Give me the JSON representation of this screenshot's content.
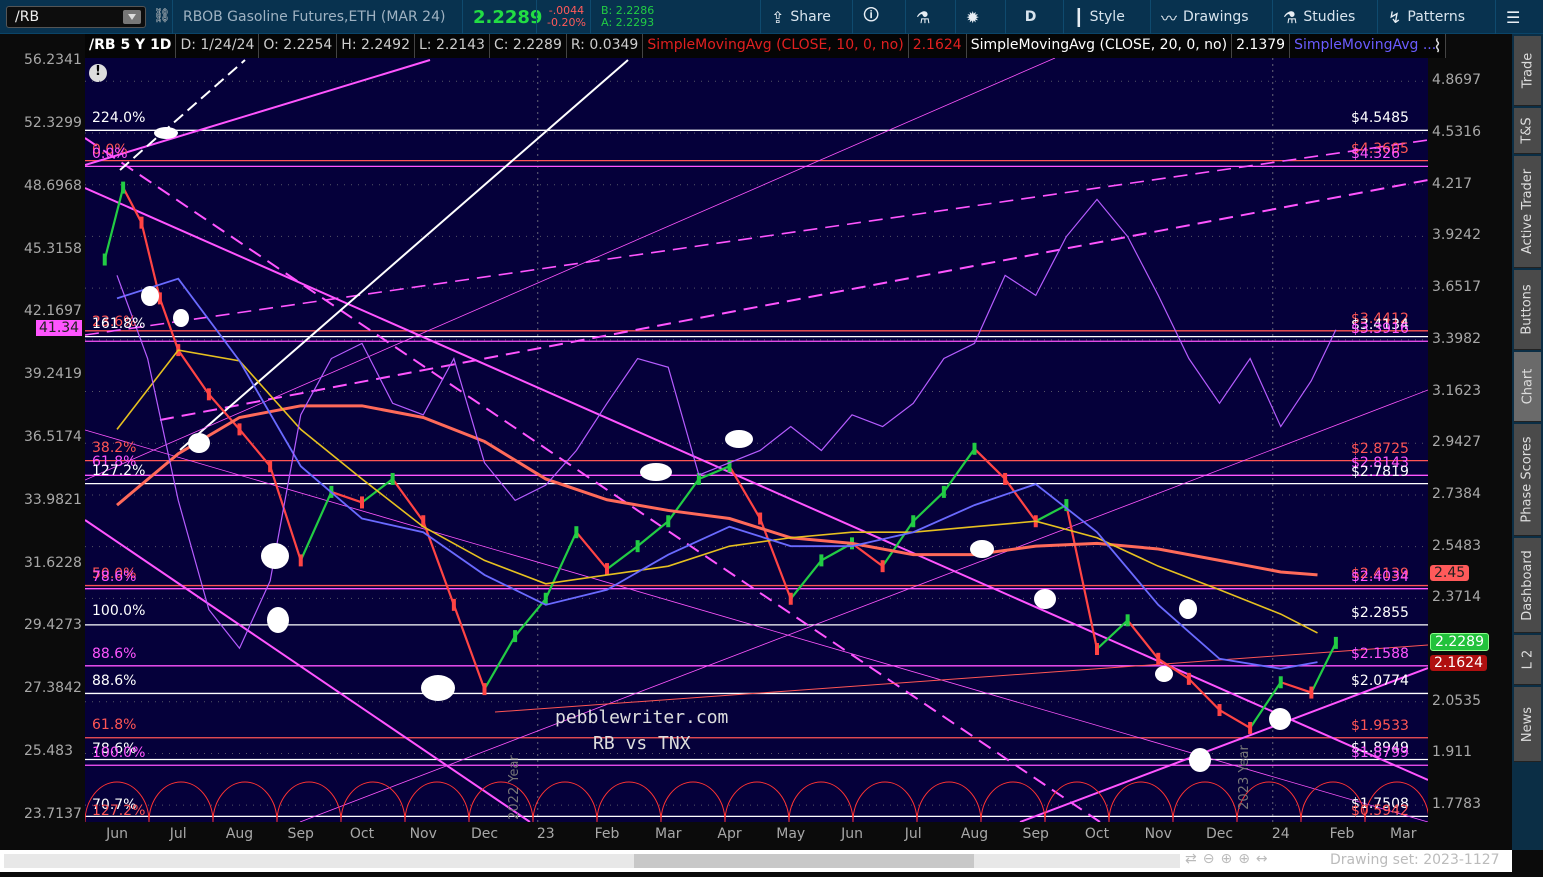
{
  "toolbar": {
    "symbol": "/RB",
    "description": "RBOB Gasoline Futures,ETH (MAR 24)",
    "last": "2.2289",
    "change": "-.0044",
    "change_pct": "-0.20%",
    "bid": "B: 2.2286",
    "ask": "A: 2.2293",
    "buttons": [
      {
        "label": "Share",
        "icon": "share-icon"
      },
      {
        "label": "",
        "icon": "info-icon"
      },
      {
        "label": "",
        "icon": "flask-icon"
      },
      {
        "label": "",
        "icon": "gear-icon"
      },
      {
        "label": "D",
        "icon": ""
      },
      {
        "label": "Style",
        "icon": "candle-icon"
      },
      {
        "label": "Drawings",
        "icon": "drawings-icon"
      },
      {
        "label": "Studies",
        "icon": "flask-icon"
      },
      {
        "label": "Patterns",
        "icon": "patterns-icon"
      },
      {
        "label": "",
        "icon": "menu-icon"
      }
    ]
  },
  "info": {
    "title": "/RB 5 Y 1D",
    "date": "D: 1/24/24",
    "open": "O: 2.2254",
    "high": "H: 2.2492",
    "low": "L: 2.2143",
    "close": "C: 2.2289",
    "range": "R: 0.0349",
    "sma1": "SimpleMovingAvg (CLOSE, 10, 0, no)",
    "sma1_val": "2.1624",
    "sma2": "SimpleMovingAvg (CLOSE, 20, 0, no)",
    "sma2_val": "2.1379",
    "sma3": "SimpleMovingAvg ..."
  },
  "left_axis": [
    "56.2341",
    "52.3299",
    "48.6968",
    "45.3158",
    "42.1697",
    "39.2419",
    "36.5174",
    "33.9821",
    "31.6228",
    "29.4273",
    "27.3842",
    "25.483",
    "23.7137"
  ],
  "left_badge": "41.34",
  "right_axis": [
    "4.8697",
    "4.5316",
    "4.217",
    "3.9242",
    "3.6517",
    "3.3982",
    "3.1623",
    "2.9427",
    "2.7384",
    "2.5483",
    "2.3714",
    "2.0535",
    "1.911",
    "1.7783"
  ],
  "badges": {
    "sma200": "2.45",
    "last": "2.2289",
    "sma10": "2.1624"
  },
  "colors": {
    "up": "#22cc44",
    "down": "#ff4444",
    "tnx": "#b65cff",
    "fib_white": "#ffffff",
    "fib_red": "#ff5555",
    "fib_magenta": "#ff55ff"
  },
  "fib_right": [
    {
      "label": "$4.5485",
      "price": 4.5485,
      "color": "#ffffff"
    },
    {
      "label": "$4.3605",
      "price": 4.3605,
      "color": "#ff5555"
    },
    {
      "label": "$4.326",
      "price": 4.326,
      "color": "#ff55ff"
    },
    {
      "label": "$3.4412",
      "price": 3.4412,
      "color": "#ff5555"
    },
    {
      "label": "$3.4134",
      "price": 3.4134,
      "color": "#ffffff"
    },
    {
      "label": "$3.3916",
      "price": 3.3916,
      "color": "#ff55ff"
    },
    {
      "label": "$2.8725",
      "price": 2.8725,
      "color": "#ff5555"
    },
    {
      "label": "$2.8143",
      "price": 2.8143,
      "color": "#ff55ff"
    },
    {
      "label": "$2.7819",
      "price": 2.7819,
      "color": "#ffffff"
    },
    {
      "label": "$2.4139",
      "price": 2.4139,
      "color": "#ff5555"
    },
    {
      "label": "$2.4034",
      "price": 2.4034,
      "color": "#ff55ff"
    },
    {
      "label": "$2.2855",
      "price": 2.2855,
      "color": "#ffffff"
    },
    {
      "label": "$2.1588",
      "price": 2.1588,
      "color": "#ff55ff"
    },
    {
      "label": "$2.0774",
      "price": 2.0774,
      "color": "#ffffff"
    },
    {
      "label": "$1.9533",
      "price": 1.9533,
      "color": "#ff5555"
    },
    {
      "label": "$1.8949",
      "price": 1.8949,
      "color": "#ffffff"
    },
    {
      "label": "$1.8799",
      "price": 1.8799,
      "color": "#ff55ff"
    },
    {
      "label": "$1.7508",
      "price": 1.7508,
      "color": "#ffffff"
    },
    {
      "label": "$0.5942",
      "price": 1.735,
      "color": "#ff5555"
    }
  ],
  "fib_left": [
    {
      "label": "224.0%",
      "color": "#ffffff"
    },
    {
      "label": "0.0%",
      "color": "#ff5555"
    },
    {
      "label": "0.0%",
      "color": "#ff55ff"
    },
    {
      "label": "23.6%",
      "color": "#ff5555"
    },
    {
      "label": "161.8%",
      "color": "#ffffff"
    },
    {
      "label": "38.2%",
      "color": "#ff5555"
    },
    {
      "label": "61.8%",
      "color": "#ff55ff"
    },
    {
      "label": "127.2%",
      "color": "#ffffff"
    },
    {
      "label": "50.0%",
      "color": "#ff5555"
    },
    {
      "label": "78.6%",
      "color": "#ff55ff"
    },
    {
      "label": "100.0%",
      "color": "#ffffff"
    },
    {
      "label": "88.6%",
      "color": "#ff55ff"
    },
    {
      "label": "88.6%",
      "color": "#ffffff"
    },
    {
      "label": "61.8%",
      "color": "#ff5555"
    },
    {
      "label": "78.6%",
      "color": "#ffffff"
    },
    {
      "label": "100.0%",
      "color": "#ff55ff"
    },
    {
      "label": "70.7%",
      "color": "#ffffff"
    },
    {
      "label": "127.2%",
      "color": "#ff5555"
    }
  ],
  "time_axis": [
    "Jun",
    "Jul",
    "Aug",
    "Sep",
    "Oct",
    "Nov",
    "Dec",
    "23",
    "Feb",
    "Mar",
    "Apr",
    "May",
    "Jun",
    "Jul",
    "Aug",
    "Sep",
    "Oct",
    "Nov",
    "Dec",
    "24",
    "Feb",
    "Mar"
  ],
  "watermark": {
    "site": "pebblewriter.com",
    "subtitle": "RB vs TNX",
    "year1": "2022 Year",
    "year2": "2023 Year"
  },
  "tabs": [
    "Trade",
    "T&S",
    "Active Trader",
    "Buttons",
    "Chart",
    "Phase Scores",
    "Dashboard",
    "L 2",
    "News"
  ],
  "bottom": {
    "drawing_set": "Drawing set: 2023-1127"
  },
  "chart_data": {
    "type": "line",
    "x_unit": "months since Jun 2022",
    "series": [
      {
        "name": "/RB close",
        "axis": "right",
        "x": [
          -0.2,
          0.1,
          0.4,
          0.7,
          1,
          1.5,
          2,
          2.5,
          3,
          3.5,
          4,
          4.5,
          5,
          5.5,
          6,
          6.5,
          7,
          7.5,
          8,
          8.5,
          9,
          9.5,
          10,
          10.5,
          11,
          11.5,
          12,
          12.5,
          13,
          13.5,
          14,
          14.5,
          15,
          15.5,
          16,
          16.5,
          17,
          17.5,
          18,
          18.5,
          19,
          19.5,
          19.9
        ],
        "values": [
          3.8,
          4.2,
          4.0,
          3.6,
          3.35,
          3.15,
          3.0,
          2.85,
          2.5,
          2.75,
          2.71,
          2.8,
          2.64,
          2.35,
          2.09,
          2.25,
          2.37,
          2.6,
          2.47,
          2.55,
          2.64,
          2.8,
          2.85,
          2.65,
          2.37,
          2.5,
          2.56,
          2.48,
          2.64,
          2.75,
          2.92,
          2.8,
          2.64,
          2.7,
          2.21,
          2.3,
          2.18,
          2.12,
          2.03,
          1.98,
          2.11,
          2.08,
          2.2289
        ]
      },
      {
        "name": "SMA 200",
        "axis": "right",
        "x": [
          0,
          1,
          2,
          3,
          4,
          5,
          6,
          7,
          8,
          9,
          10,
          11,
          12,
          13,
          14,
          15,
          16,
          17,
          18,
          19,
          19.6
        ],
        "values": [
          2.7,
          2.9,
          3.05,
          3.1,
          3.1,
          3.05,
          2.95,
          2.8,
          2.72,
          2.68,
          2.65,
          2.58,
          2.56,
          2.52,
          2.52,
          2.55,
          2.56,
          2.54,
          2.5,
          2.46,
          2.45
        ]
      },
      {
        "name": "SMA 100",
        "axis": "right",
        "x": [
          0,
          1,
          2,
          3,
          4,
          5,
          6,
          7,
          8,
          9,
          10,
          11,
          12,
          13,
          14,
          15,
          16,
          17,
          18,
          19,
          19.6
        ],
        "values": [
          3.0,
          3.35,
          3.3,
          3.0,
          2.8,
          2.62,
          2.5,
          2.42,
          2.45,
          2.48,
          2.55,
          2.58,
          2.6,
          2.6,
          2.62,
          2.64,
          2.58,
          2.48,
          2.4,
          2.32,
          2.26
        ]
      },
      {
        "name": "SMA 50",
        "axis": "right",
        "x": [
          0,
          1,
          2,
          3,
          4,
          5,
          6,
          7,
          8,
          9,
          10,
          11,
          12,
          13,
          14,
          15,
          16,
          17,
          18,
          19,
          19.6
        ],
        "values": [
          3.6,
          3.7,
          3.3,
          2.85,
          2.65,
          2.6,
          2.45,
          2.35,
          2.4,
          2.52,
          2.62,
          2.55,
          2.55,
          2.6,
          2.7,
          2.78,
          2.6,
          2.35,
          2.18,
          2.15,
          2.17
        ]
      },
      {
        "name": "TNX x10",
        "axis": "left",
        "x": [
          0,
          0.5,
          1,
          1.5,
          2,
          2.5,
          3,
          3.5,
          4,
          4.5,
          5,
          5.5,
          6,
          6.5,
          7,
          7.5,
          8,
          8.5,
          9,
          9.5,
          10,
          10.5,
          11,
          11.5,
          12,
          12.5,
          13,
          13.5,
          14,
          14.5,
          15,
          15.5,
          16,
          16.5,
          17,
          17.5,
          18,
          18.5,
          19,
          19.5,
          19.9
        ],
        "values": [
          44,
          40,
          34,
          30,
          28.7,
          31,
          37.5,
          40,
          40.7,
          38,
          37.5,
          40,
          35.5,
          34,
          34.6,
          36,
          38,
          40,
          39.6,
          35,
          35.5,
          36,
          37,
          36,
          37.5,
          37,
          38,
          40,
          40.7,
          44,
          43,
          46,
          48,
          46,
          43,
          40,
          38,
          40,
          37,
          39,
          41.34
        ]
      }
    ]
  }
}
